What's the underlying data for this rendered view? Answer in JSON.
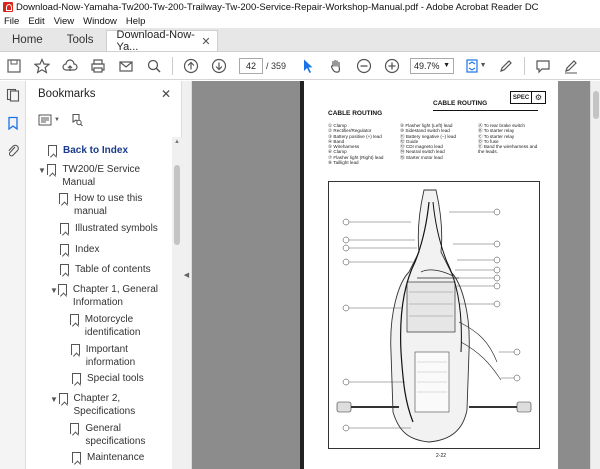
{
  "window": {
    "title": "Download-Now-Yamaha-Tw200-Tw-200-Trailway-Tw-200-Service-Repair-Workshop-Manual.pdf - Adobe Acrobat Reader DC"
  },
  "menu": [
    "File",
    "Edit",
    "View",
    "Window",
    "Help"
  ],
  "tabs": {
    "home": "Home",
    "tools": "Tools",
    "document": "Download-Now-Ya..."
  },
  "toolbar": {
    "current_page": "42",
    "page_count": "/ 359",
    "zoom": "49.7%"
  },
  "bookmarks": {
    "title": "Bookmarks",
    "items": [
      {
        "label": "Back to Index",
        "bold": true
      },
      {
        "label": "TW200/E Service Manual",
        "expanded": true
      },
      {
        "label": "How to use this manual"
      },
      {
        "label": "Illustrated symbols"
      },
      {
        "label": "Index"
      },
      {
        "label": "Table of contents"
      },
      {
        "label": "Chapter 1, General Information",
        "expanded": true
      },
      {
        "label": "Motorcycle identification"
      },
      {
        "label": "Important information"
      },
      {
        "label": "Special tools"
      },
      {
        "label": "Chapter 2, Specifications",
        "expanded": true
      },
      {
        "label": "General specifications"
      },
      {
        "label": "Maintenance"
      }
    ]
  },
  "pdf_page": {
    "header": "CABLE ROUTING",
    "spec_badge": "SPEC",
    "section_title": "CABLE ROUTING",
    "legend_col1": [
      "① Clamp",
      "② Rectifier/Regulator",
      "③ Battery positive (+) lead",
      "④ Band",
      "⑤ Wireharness",
      "⑥ Clamp",
      "⑦ Flasher light (Right) lead",
      "⑧ Taillight lead"
    ],
    "legend_col2": [
      "⑨ Flasher light (Left) lead",
      "⑩ Sidestand switch lead",
      "⑪ Battery negative (−) lead",
      "⑫ Guide",
      "⑬ CDI magneto lead",
      "⑭ Neutral switch lead",
      "⑮ Starter motor lead"
    ],
    "legend_col3": [
      "Ⓐ To rear brake switch",
      "Ⓑ To starter relay",
      "Ⓒ To starter relay",
      "Ⓓ To fuse",
      "Ⓔ Band the wireharness and",
      "   the leads."
    ],
    "page_number": "2-22"
  },
  "colors": {
    "accent_red": "#d9261c",
    "select_blue": "#1a73e8",
    "doc_bg": "#8c8c8c"
  }
}
